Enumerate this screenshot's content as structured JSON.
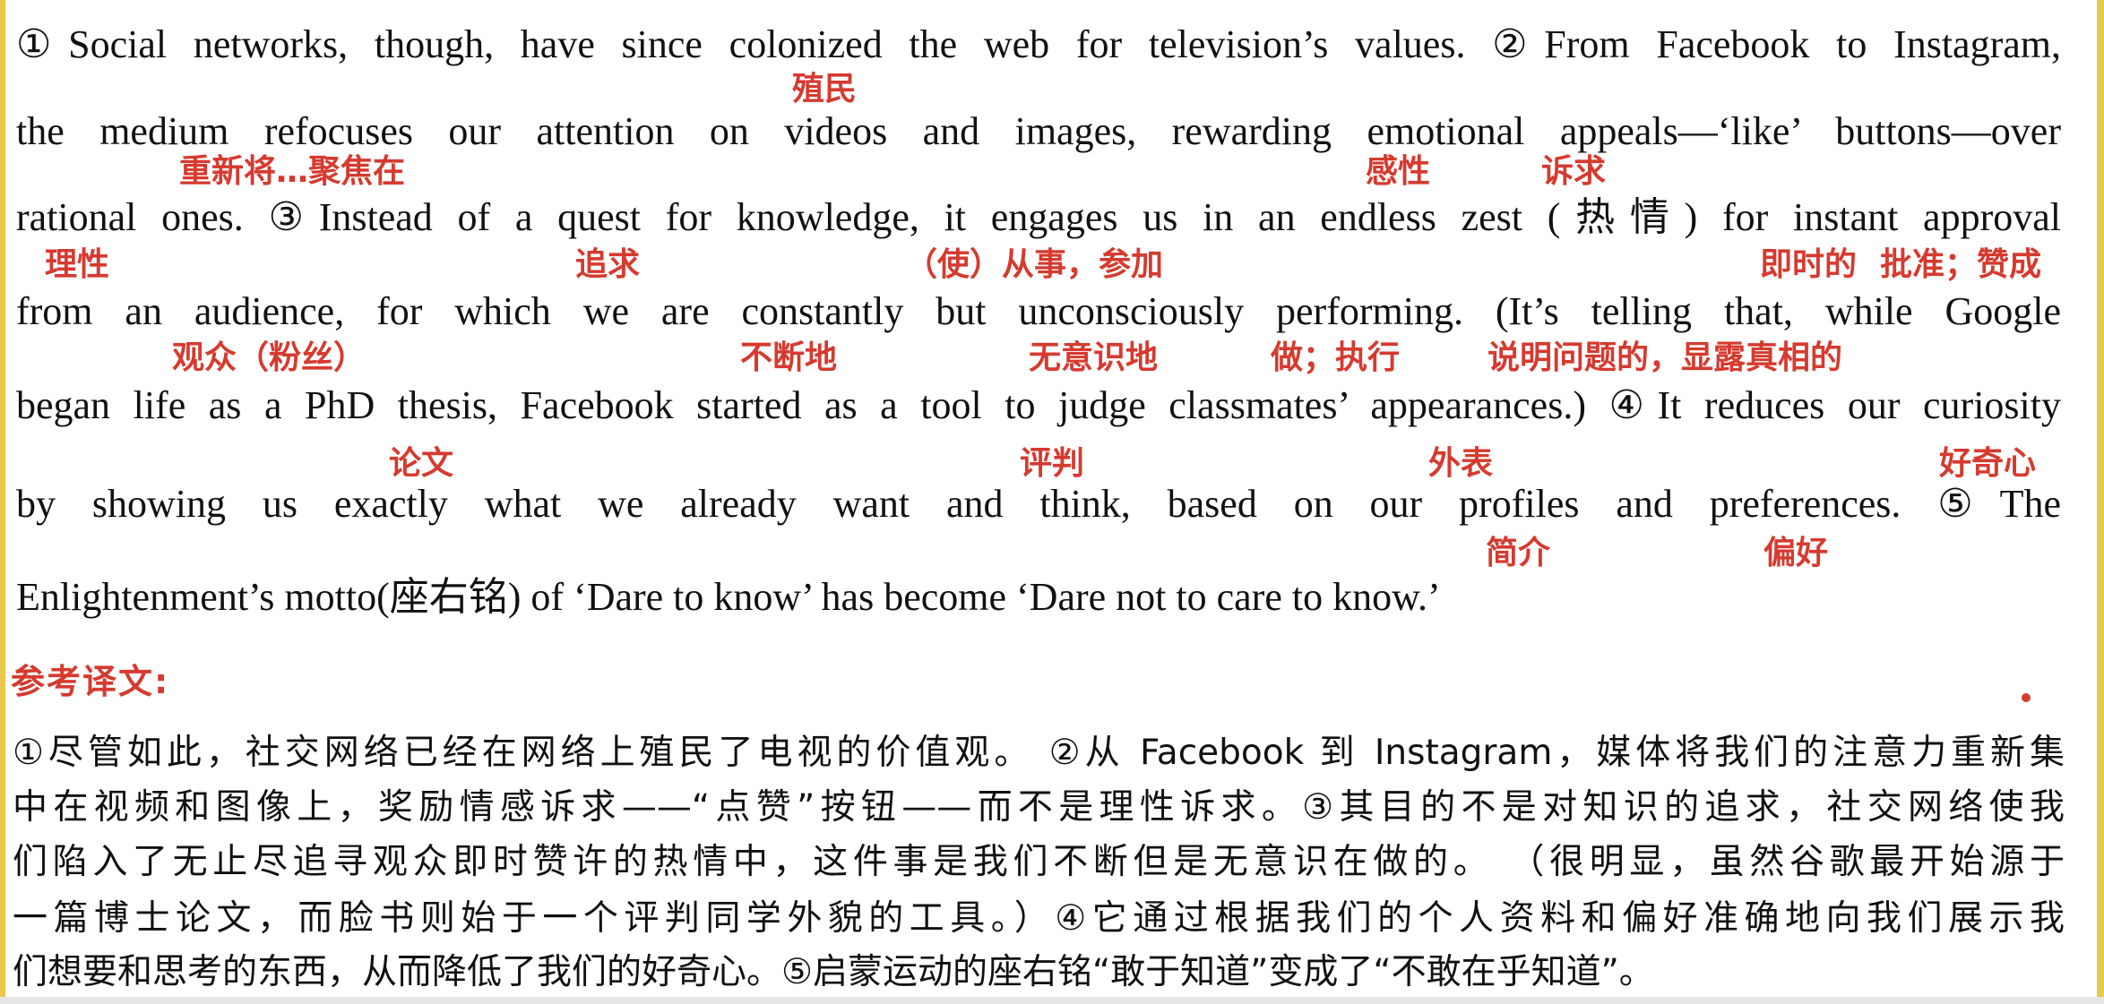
{
  "english_lines": [
    "①Social networks, though, have since colonized the web for television’s values. ②From Facebook to Instagram,",
    "the medium refocuses our attention on videos and images, rewarding emotional appeals—‘like’ buttons—over",
    "rational ones. ③Instead of a quest for knowledge, it engages us in an endless zest (热情) for instant approval",
    "from an audience, for which we are constantly but unconsciously performing. (It’s telling that, while Google",
    "began life as a PhD thesis, Facebook started as a tool to judge classmates’ appearances.) ④It reduces our curiosity",
    "by showing us exactly what we already want and think, based on our profiles and preferences. ⑤The",
    "Enlightenment’s motto(座右铭) of ‘Dare to know’ has become ‘Dare not to care to know.’"
  ],
  "annotations": [
    {
      "id": "colonize",
      "text": "殖民"
    },
    {
      "id": "refocus",
      "text": "重新将…聚焦在"
    },
    {
      "id": "emotional",
      "text": "感性"
    },
    {
      "id": "appeals",
      "text": "诉求"
    },
    {
      "id": "rational",
      "text": "理性"
    },
    {
      "id": "quest",
      "text": "追求"
    },
    {
      "id": "engage",
      "text": "（使）从事，参加"
    },
    {
      "id": "instant",
      "text": "即时的"
    },
    {
      "id": "approval",
      "text": "批准；赞成"
    },
    {
      "id": "audience",
      "text": "观众（粉丝）"
    },
    {
      "id": "constantly",
      "text": "不断地"
    },
    {
      "id": "unconsciously",
      "text": "无意识地"
    },
    {
      "id": "performing",
      "text": "做；执行"
    },
    {
      "id": "telling",
      "text": "说明问题的，显露真相的"
    },
    {
      "id": "thesis",
      "text": "论文"
    },
    {
      "id": "judge",
      "text": "评判"
    },
    {
      "id": "appearances",
      "text": "外表"
    },
    {
      "id": "curiosity",
      "text": "好奇心"
    },
    {
      "id": "profiles",
      "text": "简介"
    },
    {
      "id": "preferences",
      "text": "偏好"
    }
  ],
  "translation_title": "参考译文:",
  "translation_lines": [
    "①尽管如此，社交网络已经在网络上殖民了电视的价值观。 ②从 Facebook 到 Instagram，媒体将我们的注意力重新集",
    "中在视频和图像上，奖励情感诉求——“点赞”按钮——而不是理性诉求。③其目的不是对知识的追求，社交网络使我",
    "们陷入了无止尽追寻观众即时赞许的热情中，这件事是我们不断但是无意识在做的。 （很明显，虽然谷歌最开始源于",
    "一篇博士论文，而脸书则始于一个评判同学外貌的工具。）④它通过根据我们的个人资料和偏好准确地向我们展示我",
    "们想要和思考的东西，从而降低了我们的好奇心。⑤启蒙运动的座右铭“敢于知道”变成了“不敢在乎知道”。"
  ],
  "colors": {
    "annotation": "#d63a2f",
    "text": "#111111",
    "side_bar": "#e9c84a"
  }
}
